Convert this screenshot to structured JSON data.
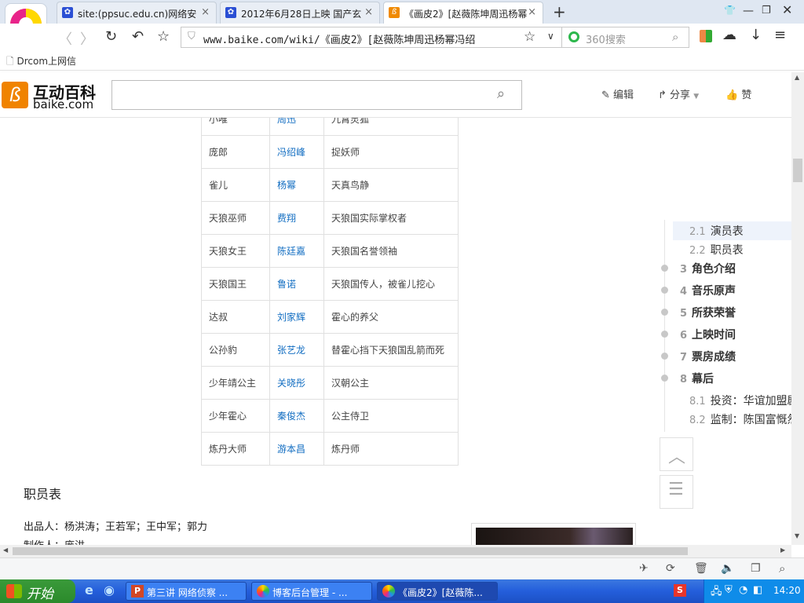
{
  "browser": {
    "tabs": [
      {
        "label": "site:(ppsuc.edu.cn)网络安",
        "close": "×",
        "favicon_color": "#2b4fd4"
      },
      {
        "label": "2012年6月28日上映 国产玄",
        "close": "×",
        "favicon_color": "#2b4fd4"
      },
      {
        "label": "《画皮2》[赵薇陈坤周迅杨幂",
        "close": "×",
        "favicon_color": "#f08a00"
      }
    ],
    "new_tab": "+",
    "url": "www.baike.com/wiki/《画皮2》[赵薇陈坤周迅杨幂冯绍",
    "search_placeholder": "360搜索",
    "bookmark": "Drcom上网信"
  },
  "site": {
    "logo_text": "互动百科",
    "logo_sub": "baike.com",
    "search_value": "",
    "edit": "编辑",
    "share": "分享",
    "like": "赞",
    "brand_color": "#f08300"
  },
  "cast_table": [
    [
      "小唯",
      "周迅",
      "九霄灵狐"
    ],
    [
      "庞郎",
      "冯绍峰",
      "捉妖师"
    ],
    [
      "雀儿",
      "杨幂",
      "天真鸟静"
    ],
    [
      "天狼巫师",
      "费翔",
      "天狼国实际掌权者"
    ],
    [
      "天狼女王",
      "陈廷嘉",
      "天狼国名誉领袖"
    ],
    [
      "天狼国王",
      "鲁诺",
      "天狼国传人，被雀儿挖心"
    ],
    [
      "达叔",
      "刘家辉",
      "霍心的养父"
    ],
    [
      "公孙豹",
      "张艺龙",
      "替霍心挡下天狼国乱箭而死"
    ],
    [
      "少年靖公主",
      "关晓彤",
      "汉朝公主"
    ],
    [
      "少年霍心",
      "秦俊杰",
      "公主侍卫"
    ],
    [
      "炼丹大师",
      "游本昌",
      "炼丹师"
    ]
  ],
  "section": {
    "title": "职员表",
    "producers": "出品人：杨洪涛；王若军；王中军；郭力",
    "partial_line": "制作人：庞洪"
  },
  "toc": [
    {
      "num": "2.1",
      "label": "演员表",
      "active": true,
      "sub": true
    },
    {
      "num": "2.2",
      "label": "职员表",
      "sub": true
    },
    {
      "num": "3",
      "label": "角色介绍"
    },
    {
      "num": "4",
      "label": "音乐原声"
    },
    {
      "num": "5",
      "label": "所获荣誉"
    },
    {
      "num": "6",
      "label": "上映时间"
    },
    {
      "num": "7",
      "label": "票房成绩"
    },
    {
      "num": "8",
      "label": "幕后"
    },
    {
      "num": "8.1",
      "label": "投资：华谊加盟剧",
      "sub": true
    },
    {
      "num": "8.2",
      "label": "监制：陈国富慨然",
      "sub": true
    }
  ],
  "taskbar": {
    "start": "开始",
    "tasks": [
      "第三讲 网络侦察 ...",
      "博客后台管理 - ...",
      "《画皮2》[赵薇陈..."
    ],
    "clock": "14:20"
  }
}
